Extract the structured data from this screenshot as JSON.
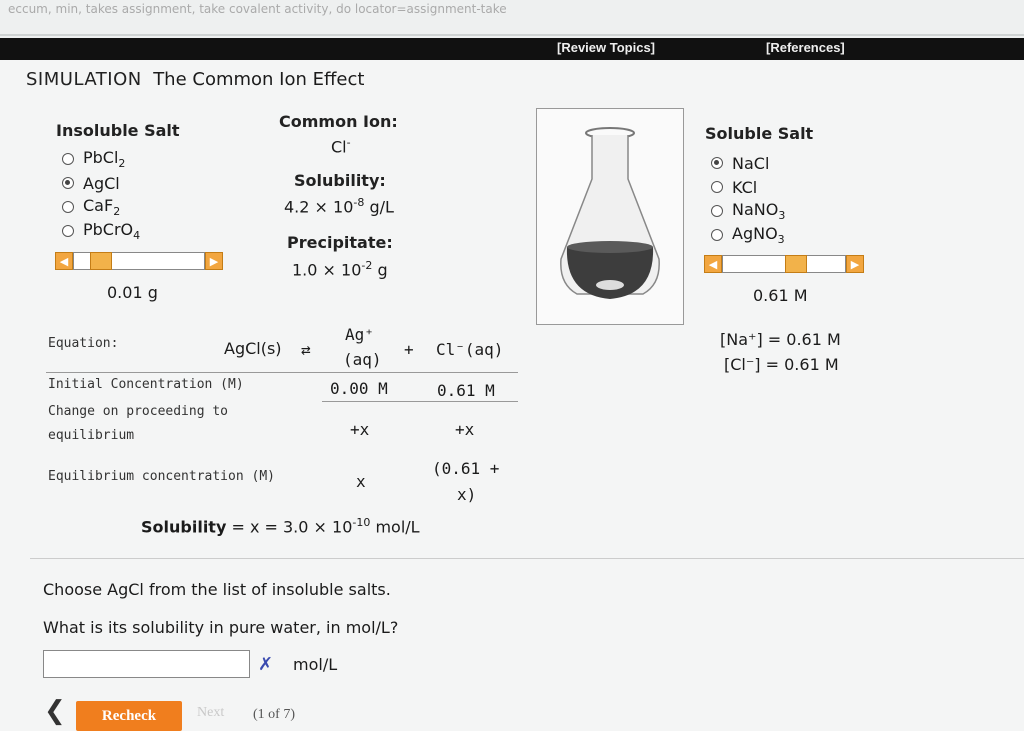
{
  "header": {
    "breadcrumb": "eccum, min, takes assignment, take covalent activity, do locator=assignment-take",
    "links": [
      "[Review Topics]",
      "[References]"
    ]
  },
  "simulation": {
    "kind": "SIMULATION",
    "title": "The Common Ion Effect"
  },
  "insoluble": {
    "heading": "Insoluble Salt",
    "options": [
      {
        "base": "PbCl",
        "sub": "2",
        "selected": false
      },
      {
        "base": "AgCl",
        "sub": "",
        "selected": true
      },
      {
        "base": "CaF",
        "sub": "2",
        "selected": false
      },
      {
        "base": "PbCrO",
        "sub": "4",
        "selected": false
      }
    ],
    "slider_left": "◀",
    "slider_right": "▶",
    "slider_fraction": 0.05,
    "amount": "0.01 g"
  },
  "common_ion": {
    "heading": "Common Ion:",
    "ion": "Cl",
    "ion_sup": "-",
    "solubility_heading": "Solubility:",
    "solubility_value": "4.2 × 10",
    "solubility_exp": "-8",
    "solubility_unit": " g/L",
    "precipitate_heading": "Precipitate:",
    "precipitate_value": "1.0 × 10",
    "precipitate_exp": "-2",
    "precipitate_unit": " g"
  },
  "soluble": {
    "heading": "Soluble Salt",
    "options": [
      {
        "base": "NaCl",
        "sub": "",
        "selected": true
      },
      {
        "base": "KCl",
        "sub": "",
        "selected": false
      },
      {
        "base": "NaNO",
        "sub": "3",
        "selected": false
      },
      {
        "base": "AgNO",
        "sub": "3",
        "selected": false
      }
    ],
    "slider_left": "◀",
    "slider_right": "▶",
    "slider_fraction": 0.6,
    "concentration": "0.61 M",
    "na_line": "[Na⁺] = 0.61 M",
    "cl_line": "[Cl⁻] = 0.61 M"
  },
  "table": {
    "equation_label": "Equation:",
    "reactant": "AgCl(s)",
    "arrow": "⇄",
    "ion1_top": "Ag⁺",
    "ion1_bottom": "(aq)",
    "plus": "+",
    "ion2": "Cl⁻(aq)",
    "initial_label": "Initial Concentration (M)",
    "initial_1": "0.00 M",
    "initial_2": "0.61 M",
    "change_label_1": "Change on proceeding to",
    "change_label_2": "equilibrium",
    "change_1": "+x",
    "change_2": "+x",
    "equilibrium_label": "Equilibrium concentration (M)",
    "equilibrium_1": "x",
    "equilibrium_2_top": "(0.61 +",
    "equilibrium_2_bottom": "x)",
    "solubility_label": "Solubility",
    "solubility_expr": " = x = 3.0 × 10",
    "solubility_exp": "-10",
    "solubility_unit": " mol/L"
  },
  "question": {
    "line1": "Choose AgCl from the list of insoluble salts.",
    "line2": "What is its solubility in pure water, in mol/L?",
    "input_value": "",
    "unit": "mol/L",
    "x_mark": "✗"
  },
  "footer": {
    "back": "❮",
    "recheck": "Recheck",
    "next": "Next",
    "page": "(1 of 7)"
  }
}
